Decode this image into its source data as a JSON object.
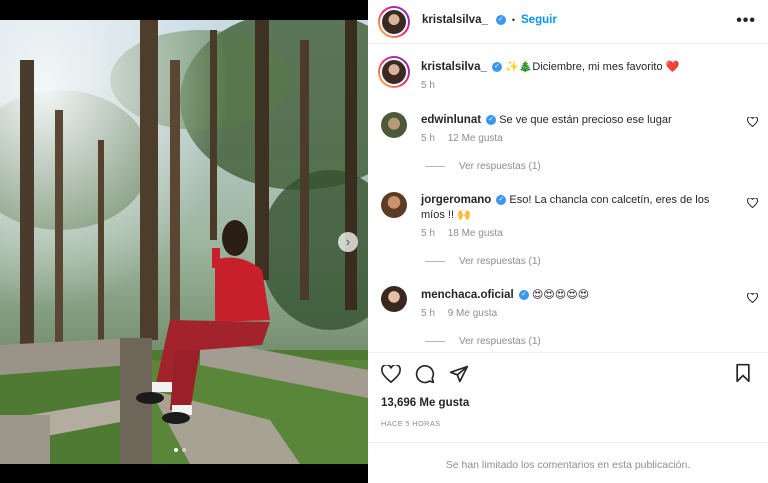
{
  "post": {
    "photo_alt": "",
    "carousel": {
      "count": 2,
      "active": 0
    }
  },
  "header": {
    "username": "kristalsilva_",
    "separator": "•",
    "follow_label": "Seguir",
    "more_label": "•••"
  },
  "caption": {
    "username": "kristalsilva_",
    "text": "✨🎄Diciembre, mi mes favorito ❤️",
    "time": "5 h"
  },
  "comments": [
    {
      "username": "edwinlunat",
      "text": "Se ve que están precioso ese lugar",
      "time": "5 h",
      "likes": "12 Me gusta",
      "replies": "Ver respuestas (1)"
    },
    {
      "username": "jorgeromano",
      "text": "Eso! La chancla con calcetín, eres de los míos !! 🙌",
      "time": "5 h",
      "likes": "18 Me gusta",
      "replies": "Ver respuestas (1)"
    },
    {
      "username": "menchaca.oficial",
      "text": "😍😍😍😍😍",
      "time": "5 h",
      "likes": "9 Me gusta",
      "replies": "Ver respuestas (1)"
    }
  ],
  "footer": {
    "likes_count": "13,696 Me gusta",
    "time_ago": "HACE 5 HORAS",
    "comments_limited": "Se han limitado los comentarios en esta publicación."
  },
  "colors": {
    "accent": "#0095f6",
    "verified": "#3897f0",
    "muted": "#8e8e8e",
    "heart": "#e0245e"
  },
  "icons": [
    "heart-icon",
    "comment-icon",
    "share-icon",
    "bookmark-icon",
    "verified-badge-icon",
    "next-arrow-icon"
  ]
}
